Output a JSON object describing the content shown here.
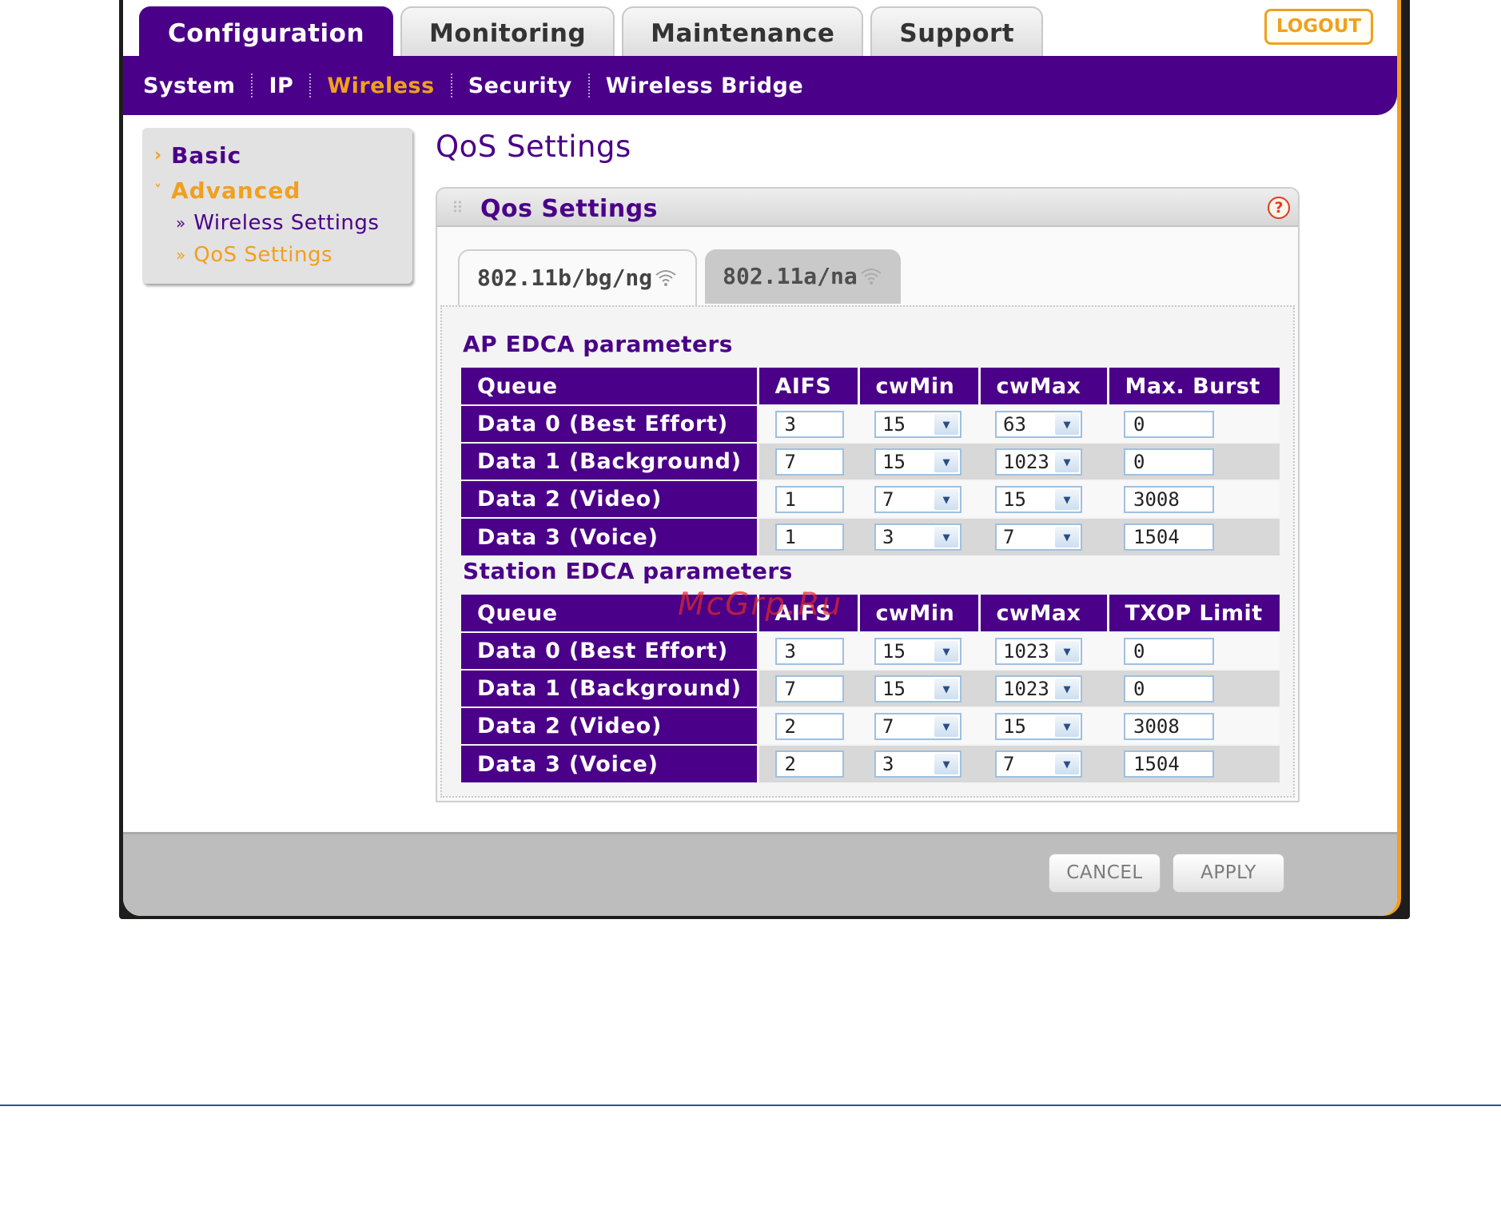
{
  "top_tabs": [
    "Configuration",
    "Monitoring",
    "Maintenance",
    "Support"
  ],
  "logout_label": "LOGOUT",
  "subnav": [
    "System",
    "IP",
    "Wireless",
    "Security",
    "Wireless Bridge"
  ],
  "sidebar": {
    "basic": "Basic",
    "advanced": "Advanced",
    "sub_items": [
      "Wireless Settings",
      "QoS Settings"
    ]
  },
  "page_title": "QoS Settings",
  "panel_title": "Qos Settings",
  "radio_tabs": [
    "802.11b/bg/ng",
    "802.11a/na"
  ],
  "ap_section": {
    "label": "AP EDCA parameters",
    "headers": [
      "Queue",
      "AIFS",
      "cwMin",
      "cwMax",
      "Max. Burst"
    ],
    "rows": [
      {
        "queue": "Data 0 (Best Effort)",
        "aifs": "3",
        "cwmin": "15",
        "cwmax": "63",
        "last": "0"
      },
      {
        "queue": "Data 1 (Background)",
        "aifs": "7",
        "cwmin": "15",
        "cwmax": "1023",
        "last": "0"
      },
      {
        "queue": "Data 2 (Video)",
        "aifs": "1",
        "cwmin": "7",
        "cwmax": "15",
        "last": "3008"
      },
      {
        "queue": "Data 3 (Voice)",
        "aifs": "1",
        "cwmin": "3",
        "cwmax": "7",
        "last": "1504"
      }
    ]
  },
  "station_section": {
    "label": "Station EDCA parameters",
    "headers": [
      "Queue",
      "AIFS",
      "cwMin",
      "cwMax",
      "TXOP Limit"
    ],
    "rows": [
      {
        "queue": "Data 0 (Best Effort)",
        "aifs": "3",
        "cwmin": "15",
        "cwmax": "1023",
        "last": "0"
      },
      {
        "queue": "Data 1 (Background)",
        "aifs": "7",
        "cwmin": "15",
        "cwmax": "1023",
        "last": "0"
      },
      {
        "queue": "Data 2 (Video)",
        "aifs": "2",
        "cwmin": "7",
        "cwmax": "15",
        "last": "3008"
      },
      {
        "queue": "Data 3 (Voice)",
        "aifs": "2",
        "cwmin": "3",
        "cwmax": "7",
        "last": "1504"
      }
    ]
  },
  "buttons": {
    "cancel": "CANCEL",
    "apply": "APPLY"
  },
  "watermark": "McGrp.Ru",
  "colors": {
    "brand_purple": "#4a0088",
    "accent_orange": "#f0a01e"
  }
}
